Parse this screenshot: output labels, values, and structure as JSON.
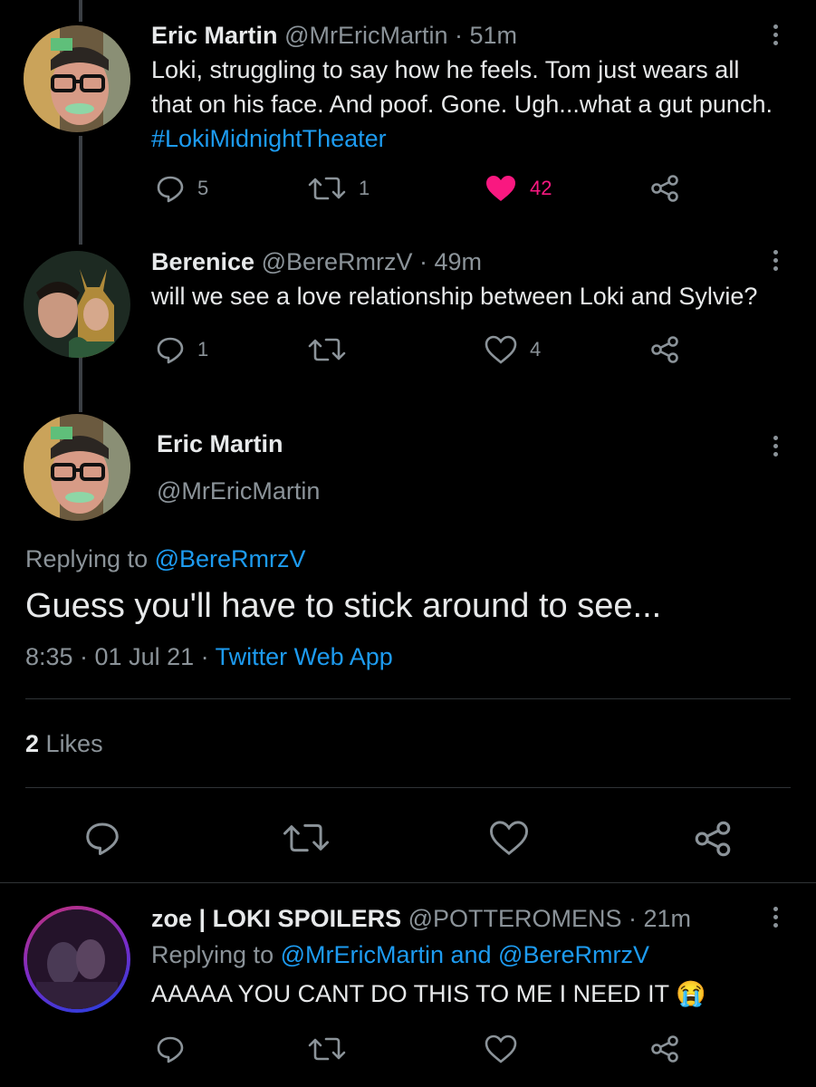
{
  "tweets": [
    {
      "name": "Eric Martin",
      "meta": "@MrEricMartin · 51m",
      "line1": "Loki, struggling to say how he feels. Tom just wears all",
      "line2": "that on his face. And poof. Gone. Ugh...what a gut punch.",
      "hashtag": "#LokiMidnightTheater",
      "replies": "5",
      "retweets": "1",
      "likes": "42"
    },
    {
      "name": "Berenice",
      "meta": "@BereRmrzV · 49m",
      "text": "will we see a love relationship between Loki and Sylvie?",
      "replies": "1",
      "likes": "4"
    }
  ],
  "focused": {
    "name": "Eric Martin",
    "handle": "@MrEricMartin",
    "replying_prefix": "Replying to ",
    "replying_to": "@BereRmrzV",
    "text": "Guess you'll have to stick around to see...",
    "timestamp": "8:35 · 01 Jul 21 · ",
    "source": "Twitter Web App",
    "likes_count": "2",
    "likes_label": "Likes"
  },
  "reply": {
    "name": "zoe | LOKI SPOILERS",
    "meta": "@POTTEROMENS · 21m",
    "replying_prefix": "Replying to ",
    "replying_to": "@MrEricMartin and @BereRmrzV",
    "text": "AAAAA YOU CANT DO THIS TO ME I NEED IT",
    "emoji": "😭"
  },
  "colors": {
    "background": "#000000",
    "text": "#e7e9ea",
    "muted": "#8b9399",
    "link": "#1d9bf0",
    "like_active": "#f91880"
  },
  "icons": [
    "reply-icon",
    "retweet-icon",
    "like-icon",
    "share-icon",
    "more-icon"
  ]
}
